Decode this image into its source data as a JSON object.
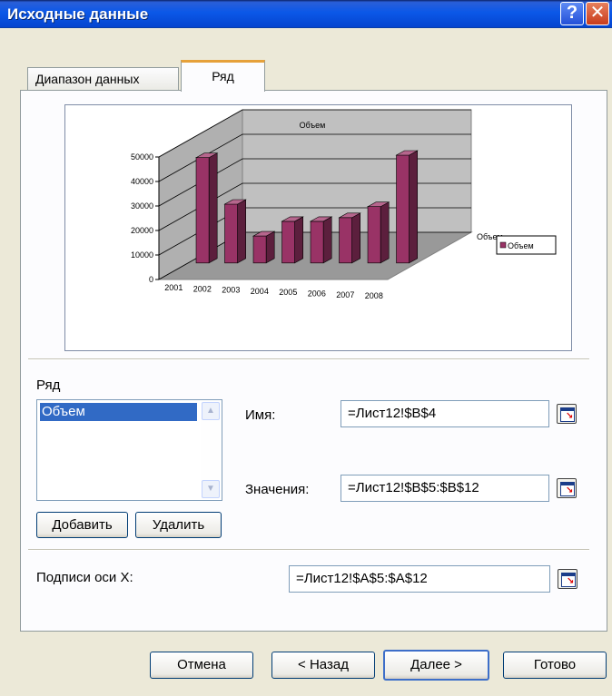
{
  "window": {
    "title": "Исходные данные",
    "help_glyph": "?",
    "close_glyph": "✕"
  },
  "tabs": [
    {
      "label": "Диапазон данных",
      "active": false
    },
    {
      "label": "Ряд",
      "active": true
    }
  ],
  "chart_data": {
    "type": "bar",
    "title": "Объем",
    "categories": [
      "2001",
      "2002",
      "2003",
      "2004",
      "2005",
      "2006",
      "2007",
      "2008"
    ],
    "series": [
      {
        "name": "Объем",
        "values": [
          43000,
          24000,
          11000,
          17000,
          17000,
          18500,
          23000,
          44000
        ]
      }
    ],
    "y_ticks": [
      "0",
      "10000",
      "20000",
      "30000",
      "40000",
      "50000"
    ],
    "ylim": [
      0,
      50000
    ],
    "series_axis_label": "Объем",
    "legend": "right",
    "bar_color": "#993366",
    "grid": true
  },
  "series_section": {
    "label": "Ряд",
    "items": [
      "Объем"
    ],
    "name_label": "Имя:",
    "name_value": "=Лист12!$B$4",
    "values_label": "Значения:",
    "values_value": "=Лист12!$B$5:$B$12",
    "add_label": "Добавить",
    "delete_label": "Удалить"
  },
  "x_labels": {
    "label": "Подписи оси X:",
    "value": "=Лист12!$A$5:$A$12"
  },
  "footer": {
    "cancel": "Отмена",
    "back": "< Назад",
    "next": "Далее >",
    "finish": "Готово"
  }
}
